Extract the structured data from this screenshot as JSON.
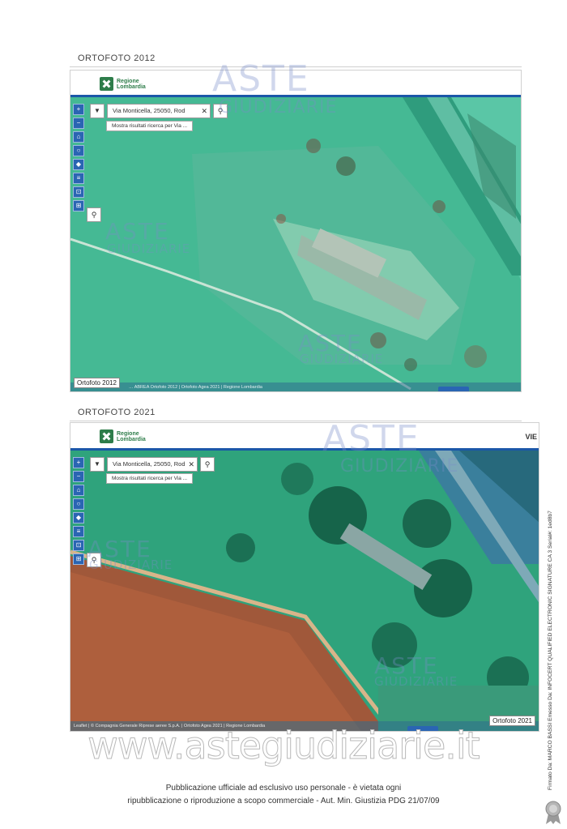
{
  "maps": [
    {
      "title": "ORTOFOTO 2012",
      "brand_line1": "Regione",
      "brand_line2": "Lombardia",
      "header_right": "",
      "search_value": "Via Monticella, 25050, Rod",
      "search_hint": "Mostra risultati ricerca per Via ...",
      "year_label": "Ortofoto 2012",
      "credits": "… ABREA Ortofoto 2012 | Ortofoto Agea 2021 | Regione Lombardia"
    },
    {
      "title": "ORTOFOTO 2021",
      "brand_line1": "Regione",
      "brand_line2": "Lombardia",
      "header_right": "VIE",
      "search_value": "Via Monticella, 25050, Rod",
      "search_hint": "Mostra risultati ricerca per Via ...",
      "year_label": "Ortofoto 2021",
      "credits": "Leaflet | © Compagnia Generale Riprese aeree S.p.A. | Ortofoto Agea 2021 | Regione Lombardia"
    }
  ],
  "tool_icons": [
    "plus-icon",
    "minus-icon",
    "home-icon",
    "circle-icon",
    "layers-icon",
    "list-icon",
    "car-icon",
    "grid-icon"
  ],
  "watermark": {
    "big": "ASTE",
    "small": "GIUDIZIARIE"
  },
  "site_url": "www.astegiudiziarie.it",
  "footer": {
    "line1": "Pubblicazione ufficiale ad esclusivo uso personale - è vietata ogni",
    "line2": "ripubblicazione o riproduzione a scopo commerciale - Aut. Min. Giustizia PDG 21/07/09"
  },
  "signature": "Firmato Da: MARCO BASSI Emesso Da: INFOCERT QUALIFIED ELECTRONIC SIGNATURE CA 3 Serial#: 1ed8b7"
}
